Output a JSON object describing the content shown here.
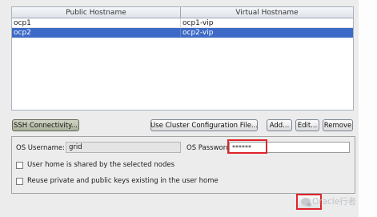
{
  "table": {
    "columns": [
      "Public Hostname",
      "Virtual Hostname"
    ],
    "rows": [
      {
        "public": "ocp1",
        "virtual": "ocp1-vip",
        "selected": false
      },
      {
        "public": "ocp2",
        "virtual": "ocp2-vip",
        "selected": true
      }
    ]
  },
  "buttons": {
    "ssh": "SSH Connectivity...",
    "cluster": "Use Cluster Configuration File...",
    "add": "Add...",
    "edit": "Edit...",
    "remove": "Remove"
  },
  "credentials": {
    "username_label": "OS Username:",
    "username_value": "grid",
    "password_label": "OS Password",
    "password_value": "******"
  },
  "options": {
    "shared_home": {
      "label": "User home is shared by the selected nodes",
      "checked": false
    },
    "reuse_keys": {
      "label": "Reuse private and public keys existing in the user home",
      "checked": false
    }
  },
  "watermark": {
    "text": "Oracle行者",
    "icon": "wechat-icon"
  },
  "colors": {
    "selection": "#3d6ac6",
    "highlight": "#e0242a"
  }
}
